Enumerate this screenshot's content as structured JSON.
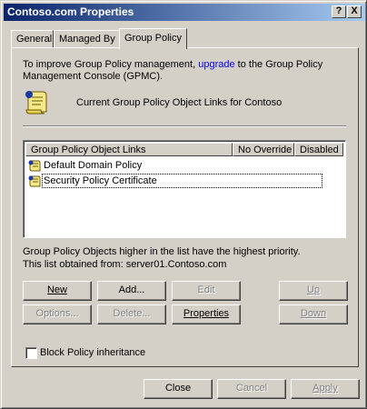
{
  "window": {
    "title": "Contoso.com Properties",
    "help_label": "?",
    "close_label": "X"
  },
  "tabs": [
    {
      "label": "General"
    },
    {
      "label": "Managed By"
    },
    {
      "label": "Group Policy",
      "active": true
    }
  ],
  "intro": {
    "text_before": "To improve Group Policy management,",
    "link": "upgrade",
    "text_after": "to the Group Policy",
    "line2": "Management Console (GPMC)."
  },
  "current_links_label": "Current Group Policy Object Links for Contoso",
  "list": {
    "columns": [
      "Group Policy Object Links",
      "No Override",
      "Disabled"
    ],
    "rows": [
      {
        "name": "Default Domain Policy",
        "icon": "gpo-scroll-icon",
        "selected": false
      },
      {
        "name": "Security Policy Certificate",
        "icon": "gpo-scroll-icon",
        "selected": true
      }
    ]
  },
  "priority_note": "Group Policy Objects higher in the list have the highest priority.",
  "obtained_from": "This list obtained from: server01.Contoso.com",
  "buttons": {
    "new": "New",
    "add": "Add...",
    "edit": "Edit",
    "up": "Up",
    "options": "Options...",
    "delete": "Delete...",
    "properties": "Properties",
    "down": "Down"
  },
  "block_inheritance": {
    "label": "Block Policy inheritance",
    "checked": false
  },
  "footer": {
    "close": "Close",
    "cancel": "Cancel",
    "apply": "Apply"
  },
  "colors": {
    "titlebar_start": "#0a246a",
    "titlebar_end": "#a6caf0",
    "link": "#0000ff",
    "face": "#d4d0c8"
  }
}
